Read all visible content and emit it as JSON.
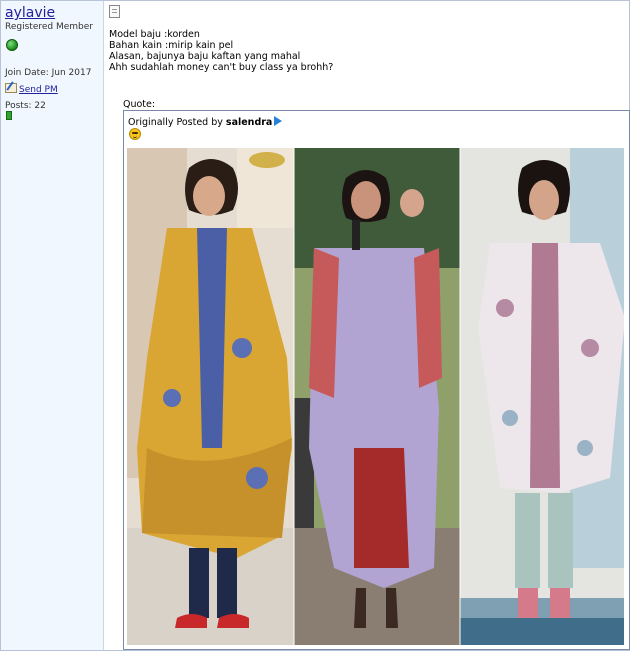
{
  "user": {
    "name": "aylavie",
    "title": "Registered Member",
    "join_date": "Join Date: Jun 2017",
    "send_pm": "Send PM",
    "posts": "Posts: 22"
  },
  "message": {
    "lines": [
      "Model baju :korden",
      "Bahan kain :mirip kain pel",
      "Alasan, bajunya baju kaftan yang mahal",
      "Ahh sudahlah money can't buy class ya brohh?"
    ]
  },
  "quote": {
    "label": "Quote:",
    "prefix": "Originally Posted by",
    "author": "salendra"
  },
  "colors": {
    "username": "#22229c",
    "sidebar_bg": "#f1f7fe",
    "quote_border": "#7a8aa6"
  },
  "icons": {
    "online": "online-status-icon",
    "send_pm": "send-pm-icon",
    "post": "post-document-icon",
    "view_post": "view-post-arrow-icon",
    "smiley": "smiley-icon"
  }
}
